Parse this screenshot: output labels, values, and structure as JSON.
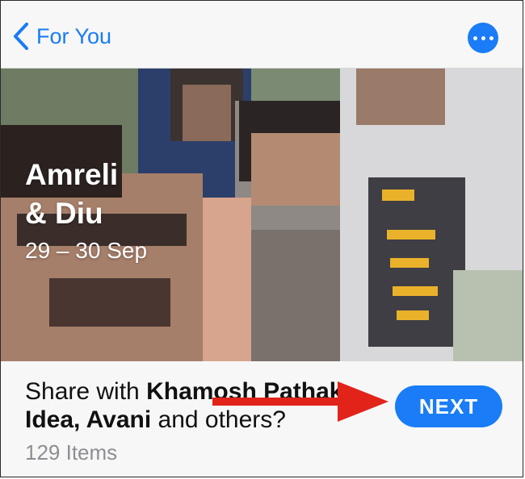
{
  "colors": {
    "accent": "#1a7cf6",
    "annotation_arrow": "#e2231a"
  },
  "nav": {
    "back_label": "For You",
    "back_icon": "chevron-left-icon",
    "more_icon": "ellipsis-icon"
  },
  "memory": {
    "title_line1": "Amreli",
    "title_line2": "& Diu",
    "dates": "29 – 30 Sep"
  },
  "share_prompt": {
    "lead": "Share with ",
    "names": "Khamosh Pathak, Idea, Avani",
    "tail": " and others?",
    "items_count": "129 Items",
    "next_label": "NEXT"
  }
}
